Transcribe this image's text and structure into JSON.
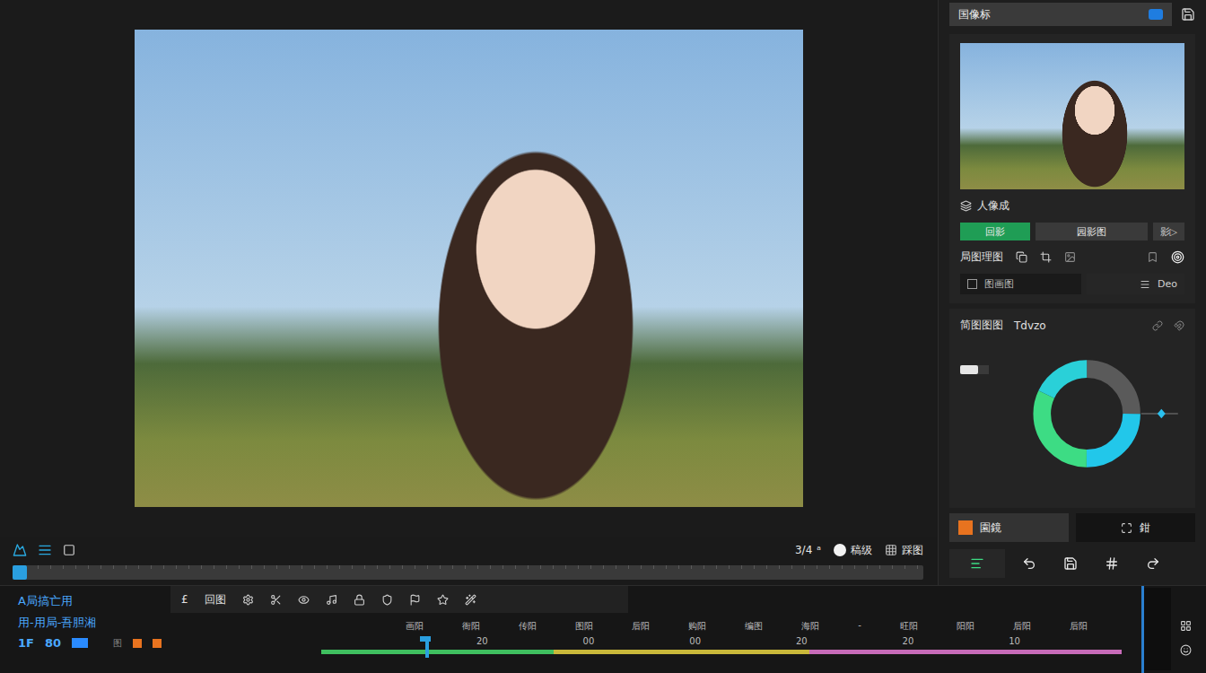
{
  "header": {
    "title": "国像标"
  },
  "transport": {
    "ratio": "3/4",
    "ratio_mark": "ᵃ",
    "quality": "稿级",
    "layout": "踩图",
    "scrubber": {
      "level": 0.0
    }
  },
  "inspector": {
    "clip_label": "人像成",
    "mode_buttons": [
      {
        "label": "回影",
        "selected": true
      },
      {
        "label": "园影图",
        "selected": false
      }
    ],
    "next_button": "影▷",
    "tool_label": "局图理图",
    "option": {
      "label": "图画图",
      "checked": false
    },
    "field": "Deo",
    "color_title": "简图图图",
    "color_value": "Tdvzo",
    "switch_on": true,
    "ring": [
      {
        "level": 0.25,
        "color": "#5a5a5a"
      },
      {
        "level": 0.25,
        "color": "#22c7ea"
      },
      {
        "level": 0.32,
        "color": "#3ddc84"
      },
      {
        "level": 0.18,
        "color": "#2ad0d8"
      }
    ],
    "slider_level": 0.55,
    "actions": [
      {
        "label": "園鏡",
        "kind": "accent"
      },
      {
        "label": "鉗",
        "kind": "plain"
      }
    ],
    "tool_tabs": [
      {
        "selected": true
      },
      {
        "selected": false
      },
      {
        "selected": false
      },
      {
        "selected": false
      },
      {
        "selected": false
      }
    ]
  },
  "timeline": {
    "track_labels": [
      "A局搞亡用",
      "用-用局-吾胆湘"
    ],
    "counters": [
      "1F",
      "80"
    ],
    "tag": "图",
    "tool_prefix": "£",
    "tool_label": "回图",
    "ruler_labels": [
      "画阳",
      "衙阳",
      "传阳",
      "图阳",
      "后阳",
      "购阳",
      "编图",
      "海阳",
      "-",
      "旺阳",
      "阳阳",
      "后阳",
      "后阳"
    ],
    "times": [
      "20",
      "00",
      "00",
      "20",
      "20",
      "10"
    ],
    "bar": [
      {
        "level": 0.29,
        "color": "#3fbf5f"
      },
      {
        "level": 0.32,
        "color": "#c9b83a"
      },
      {
        "level": 0.39,
        "color": "#c76bb8"
      }
    ],
    "playhead": 0.13
  }
}
